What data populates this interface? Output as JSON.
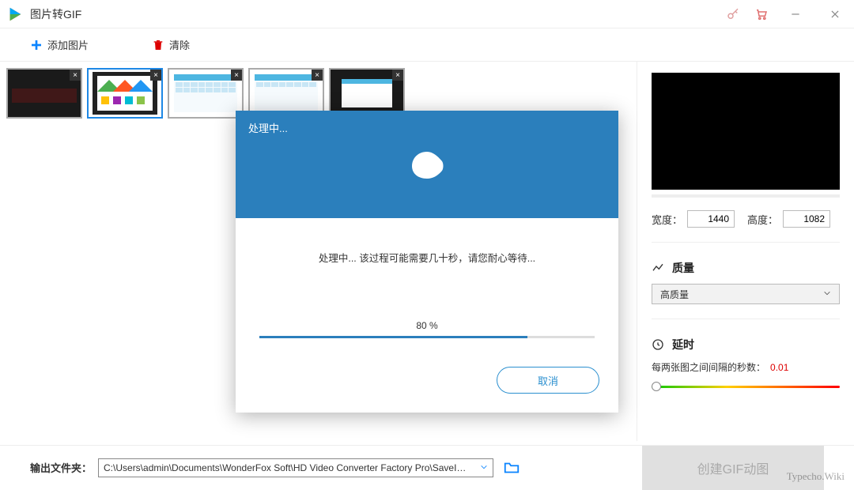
{
  "app": {
    "title": "图片转GIF"
  },
  "toolbar": {
    "add_label": "添加图片",
    "clear_label": "清除"
  },
  "thumbs": {
    "count": 5,
    "selected_index": 1
  },
  "right": {
    "width_label": "宽度：",
    "width_value": "1440",
    "height_label": "高度：",
    "height_value": "1082",
    "quality_title": "质量",
    "quality_value": "高质量",
    "delay_title": "延时",
    "delay_label": "每两张图之间间隔的秒数：",
    "delay_value": "0.01"
  },
  "bottom": {
    "out_label": "输出文件夹：",
    "out_path": "C:\\Users\\admin\\Documents\\WonderFox Soft\\HD Video Converter Factory Pro\\SaveImage\\",
    "create_label": "创建GIF动图"
  },
  "modal": {
    "title": "处理中...",
    "message": "处理中... 该过程可能需要几十秒，请您耐心等待...",
    "progress_text": "80 %",
    "progress_pct": 80,
    "cancel_label": "取消"
  },
  "watermark": "Typecho.Wiki"
}
